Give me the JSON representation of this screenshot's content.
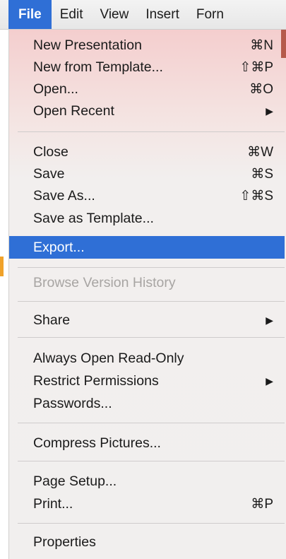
{
  "menubar": {
    "items": [
      "File",
      "Edit",
      "View",
      "Insert",
      "Forn"
    ]
  },
  "file_menu": {
    "groups": [
      [
        {
          "label": "New Presentation",
          "shortcut": "⌘N"
        },
        {
          "label": "New from Template...",
          "shortcut": "⇧⌘P"
        },
        {
          "label": "Open...",
          "shortcut": "⌘O"
        },
        {
          "label": "Open Recent",
          "submenu": "▶"
        }
      ],
      [
        {
          "label": "Close",
          "shortcut": "⌘W"
        },
        {
          "label": "Save",
          "shortcut": "⌘S"
        },
        {
          "label": "Save As...",
          "shortcut": "⇧⌘S"
        },
        {
          "label": "Save as Template..."
        },
        {
          "label": "Export...",
          "highlighted": true
        }
      ],
      [
        {
          "label": "Browse Version History",
          "disabled": true
        }
      ],
      [
        {
          "label": "Share",
          "submenu": "▶"
        }
      ],
      [
        {
          "label": "Always Open Read-Only"
        },
        {
          "label": "Restrict Permissions",
          "submenu": "▶"
        },
        {
          "label": "Passwords..."
        }
      ],
      [
        {
          "label": "Compress Pictures..."
        }
      ],
      [
        {
          "label": "Page Setup..."
        },
        {
          "label": "Print...",
          "shortcut": "⌘P"
        }
      ],
      [
        {
          "label": "Properties"
        }
      ]
    ]
  },
  "colors": {
    "highlight": "#2f6fd6",
    "disabled_text": "#a8a5a3"
  }
}
